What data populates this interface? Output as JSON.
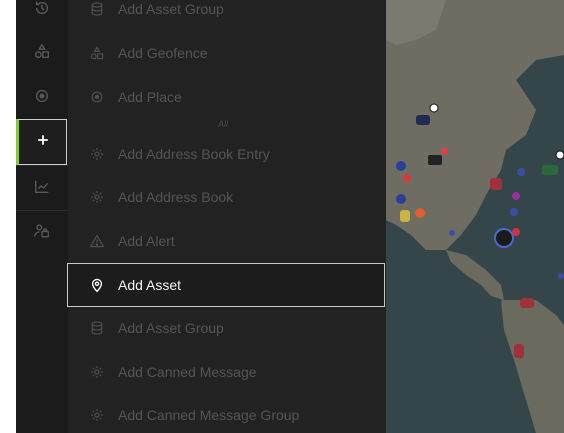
{
  "rail": {
    "items": [
      {
        "name": "history-icon"
      },
      {
        "name": "shapes-icon"
      },
      {
        "name": "place-target-icon"
      },
      {
        "name": "add-plus-icon",
        "active": true
      },
      {
        "name": "reports-chart-icon"
      },
      {
        "name": "users-icon"
      }
    ],
    "accent_color": "#8cc63f"
  },
  "menu": {
    "ghost_text": "All",
    "items": [
      {
        "label": "Add Asset Group",
        "icon": "database-icon"
      },
      {
        "label": "Add Geofence",
        "icon": "shapes-icon"
      },
      {
        "label": "Add Place",
        "icon": "place-target-icon"
      },
      {
        "label": "Add Address Book Entry",
        "icon": "gear-icon"
      },
      {
        "label": "Add Address Book",
        "icon": "gear-icon"
      },
      {
        "label": "Add Alert",
        "icon": "warning-icon"
      },
      {
        "label": "Add Asset",
        "icon": "location-pin-icon",
        "selected": true
      },
      {
        "label": "Add Asset Group",
        "icon": "database-icon"
      },
      {
        "label": "Add Canned Message",
        "icon": "gear-icon"
      },
      {
        "label": "Add Canned Message Group",
        "icon": "gear-icon"
      }
    ]
  },
  "colors": {
    "rail_bg": "#1b1b1b",
    "menu_bg": "#222222",
    "text_dim": "#555555",
    "text_active": "#f2f2f2"
  }
}
